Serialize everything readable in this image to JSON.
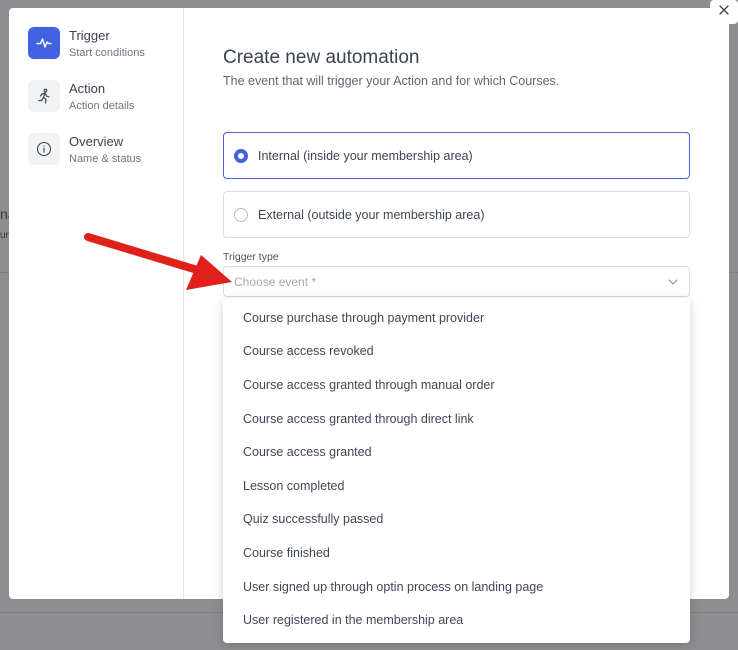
{
  "sidebar": {
    "steps": [
      {
        "title": "Trigger",
        "subtitle": "Start conditions",
        "icon": "pulse-icon",
        "active": true
      },
      {
        "title": "Action",
        "subtitle": "Action details",
        "icon": "running-person-icon",
        "active": false
      },
      {
        "title": "Overview",
        "subtitle": "Name & status",
        "icon": "info-icon",
        "active": false
      }
    ]
  },
  "main": {
    "title": "Create new automation",
    "subtitle": "The event that will trigger your Action and for which Courses.",
    "options": [
      {
        "label": "Internal (inside your membership area)",
        "selected": true
      },
      {
        "label": "External (outside your membership area)",
        "selected": false
      }
    ],
    "trigger_type": {
      "label": "Trigger type",
      "placeholder": "Choose event *"
    }
  },
  "dropdown": {
    "items": [
      "Course purchase through payment provider",
      "Course access revoked",
      "Course access granted through manual order",
      "Course access granted through direct link",
      "Course access granted",
      "Lesson completed",
      "Quiz successfully passed",
      "Course finished",
      "User signed up through optin process on landing page",
      "User registered in the membership area"
    ]
  },
  "background": {
    "fragment_1": "na",
    "fragment_2": "ur"
  },
  "colors": {
    "accent": "#4361e3",
    "arrow": "#e0201b",
    "overlay": "#8e8e91"
  }
}
